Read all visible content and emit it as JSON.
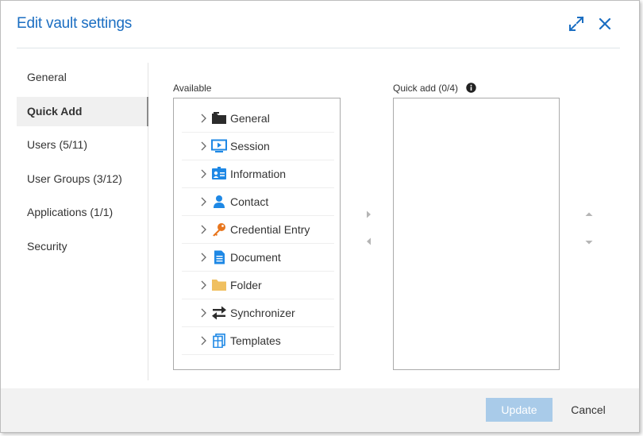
{
  "dialog": {
    "title": "Edit vault settings",
    "expand_icon": "expand-icon",
    "close_icon": "close-icon"
  },
  "sidebar": {
    "items": [
      {
        "label": "General",
        "active": false
      },
      {
        "label": "Quick Add",
        "active": true
      },
      {
        "label": "Users (5/11)",
        "active": false
      },
      {
        "label": "User Groups (3/12)",
        "active": false
      },
      {
        "label": "Applications (1/1)",
        "active": false
      },
      {
        "label": "Security",
        "active": false
      }
    ]
  },
  "available": {
    "label": "Available",
    "items": [
      {
        "label": "General",
        "icon": "folder-dark-icon"
      },
      {
        "label": "Session",
        "icon": "session-icon"
      },
      {
        "label": "Information",
        "icon": "id-card-icon"
      },
      {
        "label": "Contact",
        "icon": "person-icon"
      },
      {
        "label": "Credential Entry",
        "icon": "key-icon"
      },
      {
        "label": "Document",
        "icon": "document-icon"
      },
      {
        "label": "Folder",
        "icon": "folder-icon"
      },
      {
        "label": "Synchronizer",
        "icon": "sync-arrows-icon"
      },
      {
        "label": "Templates",
        "icon": "templates-icon"
      }
    ]
  },
  "quick_add": {
    "label": "Quick add (0/4)",
    "info_icon": "info-icon",
    "items": []
  },
  "footer": {
    "update_label": "Update",
    "cancel_label": "Cancel"
  },
  "colors": {
    "accent": "#1b6ec2",
    "update_disabled": "#a9cbe9",
    "footer_bg": "#f2f2f2",
    "key_orange": "#e8761e",
    "folder_yellow": "#f0c060",
    "icon_blue": "#1e88e5"
  }
}
